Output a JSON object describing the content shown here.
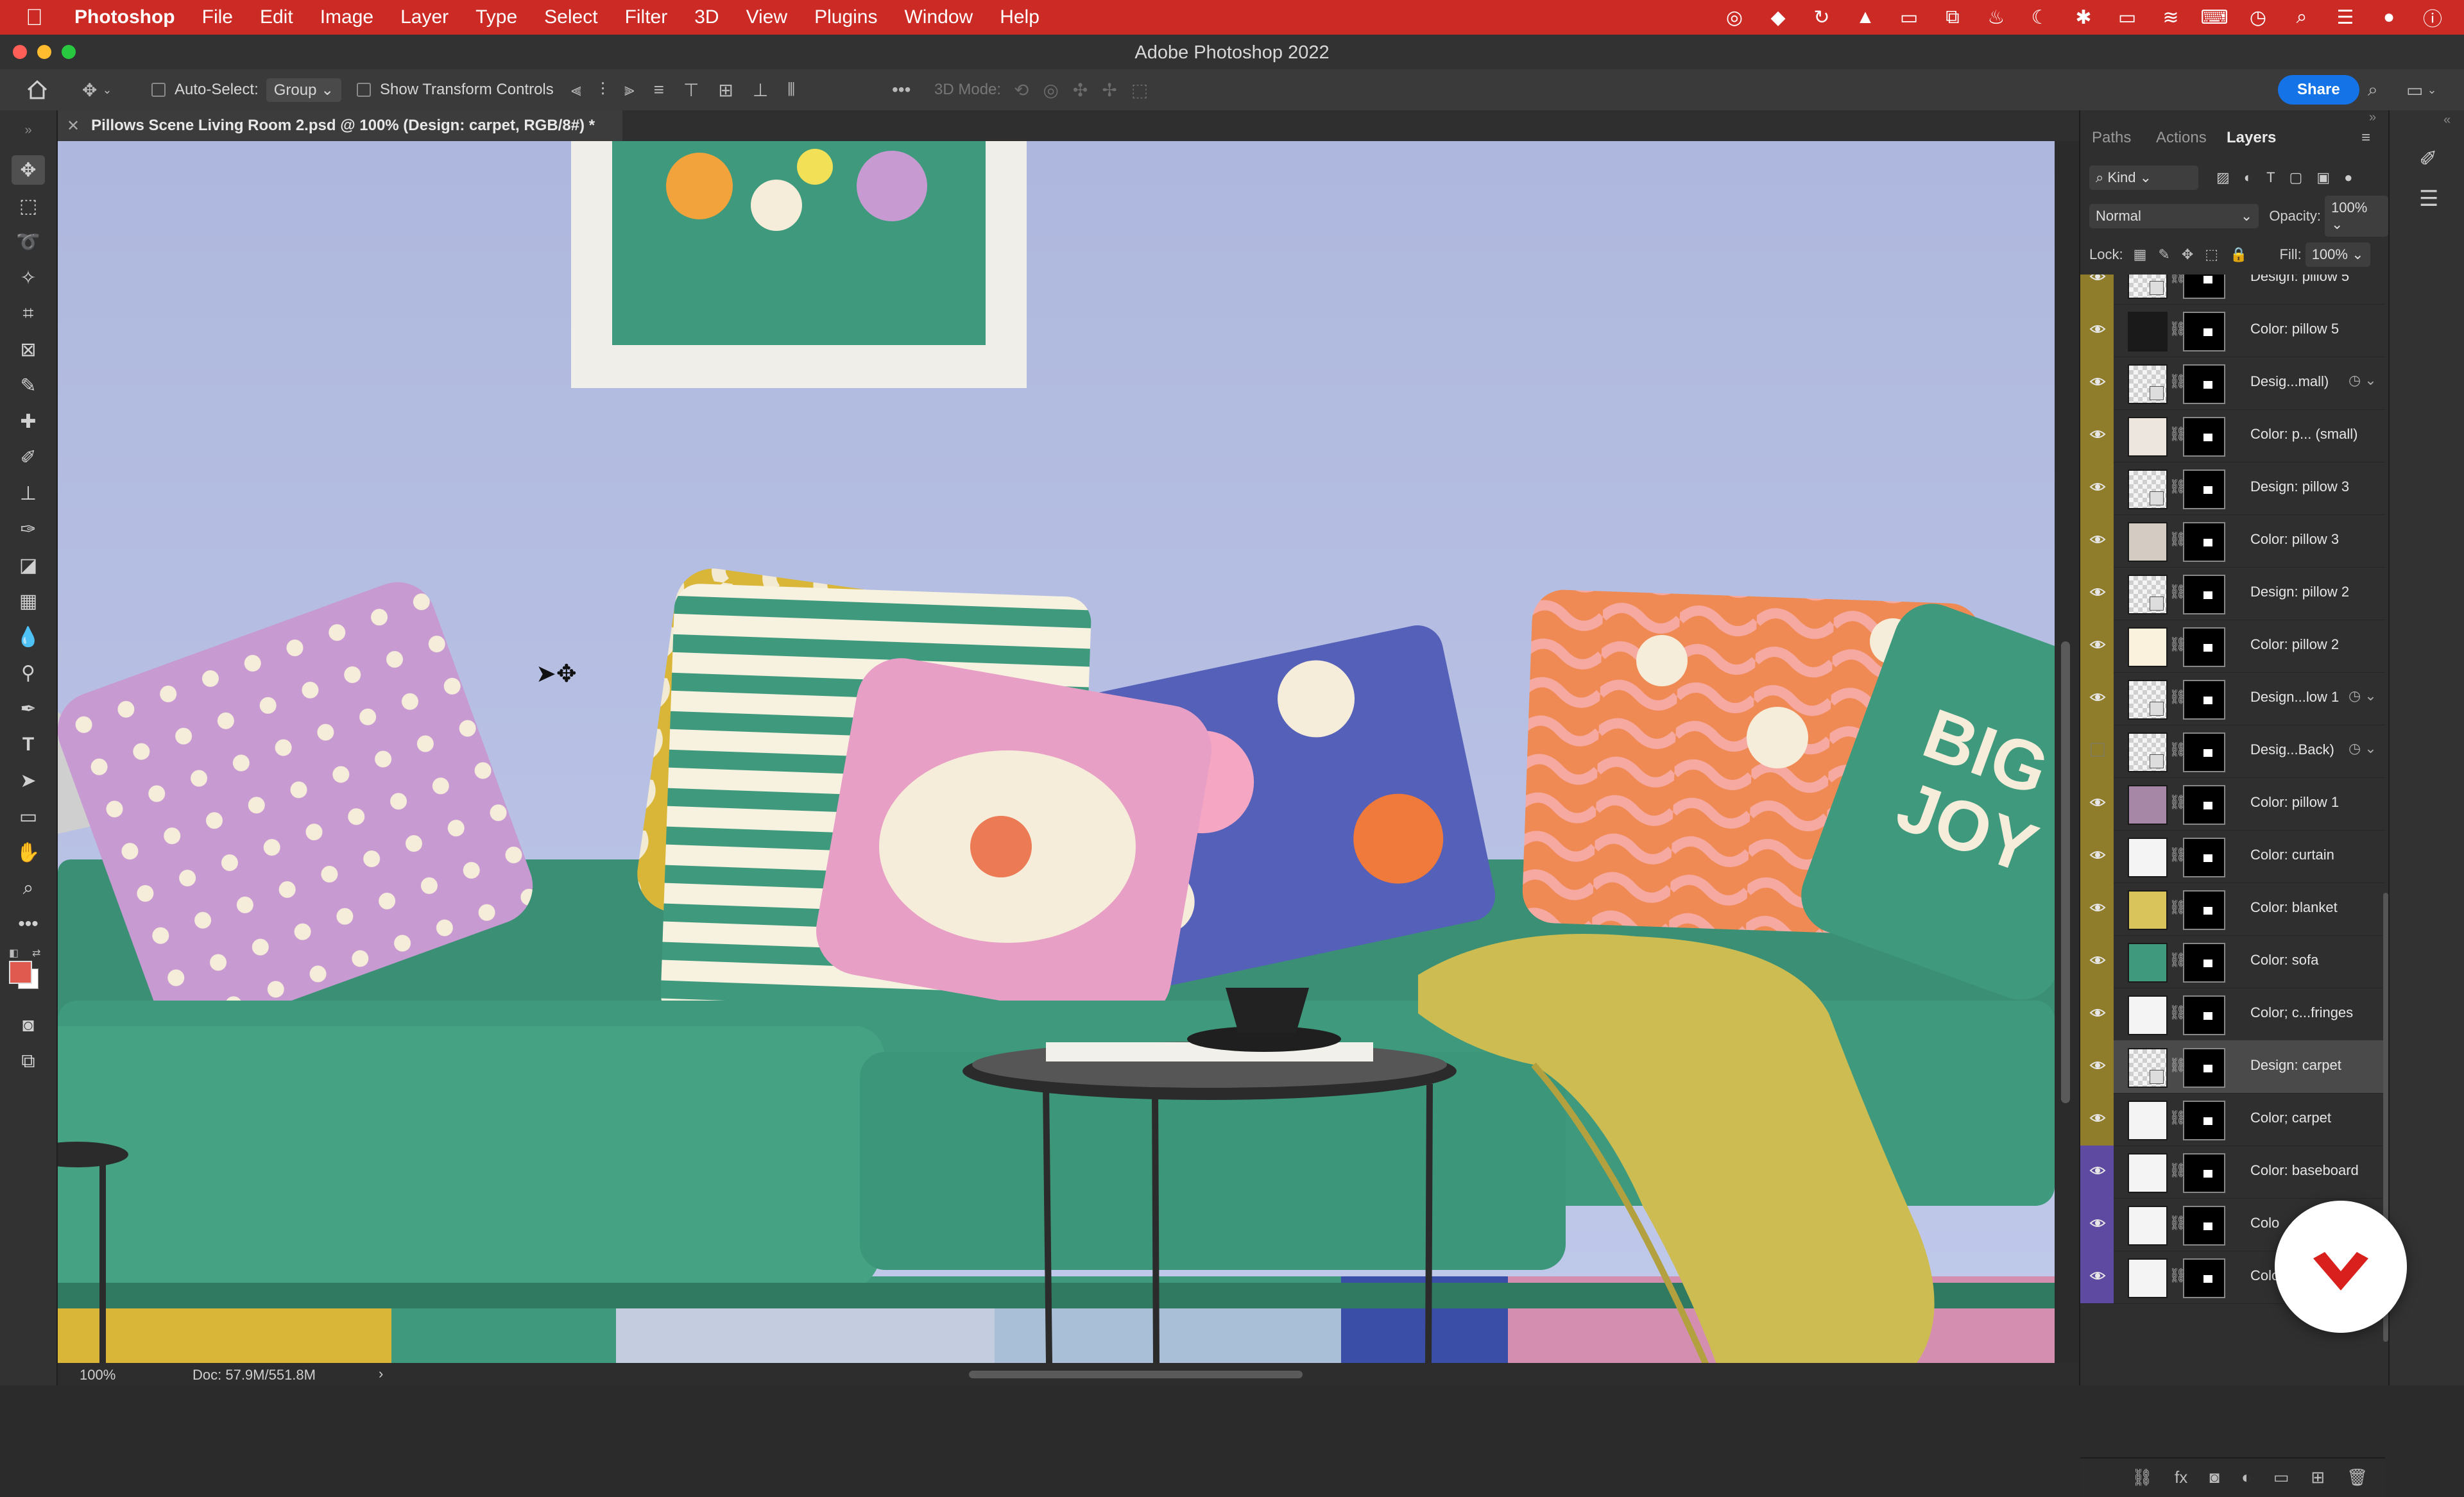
{
  "menubar": {
    "app_name": "Photoshop",
    "items": [
      "File",
      "Edit",
      "Image",
      "Layer",
      "Type",
      "Select",
      "Filter",
      "3D",
      "View",
      "Plugins",
      "Window",
      "Help"
    ]
  },
  "window": {
    "title": "Adobe Photoshop 2022"
  },
  "options": {
    "auto_select_label": "Auto-Select:",
    "auto_select_value": "Group",
    "transform_label": "Show Transform Controls",
    "mode_3d_label": "3D Mode:",
    "share_label": "Share"
  },
  "document": {
    "tab_title": "Pillows Scene Living Room 2.psd @ 100% (Design: carpet, RGB/8#) *"
  },
  "status": {
    "zoom": "100%",
    "doc_size": "Doc: 57.9M/551.8M",
    "arrow": "›"
  },
  "panel": {
    "tabs": [
      "Paths",
      "Actions",
      "Layers"
    ],
    "kind_label": "Kind",
    "blend_mode": "Normal",
    "opacity_label": "Opacity:",
    "opacity_value": "100%",
    "lock_label": "Lock:",
    "fill_label": "Fill:",
    "fill_value": "100%"
  },
  "layers": [
    {
      "name": "Design: pillow 5",
      "group": "yellow",
      "visible": true,
      "thumb": "checker",
      "smart": true
    },
    {
      "name": "Color: pillow 5",
      "group": "yellow",
      "visible": true,
      "thumb": "#1a1a1a"
    },
    {
      "name": "Desig...mall)",
      "group": "yellow",
      "visible": true,
      "thumb": "checker",
      "smart": true,
      "extra": "◷ ⌄"
    },
    {
      "name": "Color: p... (small)",
      "group": "yellow",
      "visible": true,
      "thumb": "#ece6de"
    },
    {
      "name": "Design: pillow 3",
      "group": "yellow",
      "visible": true,
      "thumb": "checker",
      "smart": true
    },
    {
      "name": "Color: pillow 3",
      "group": "yellow",
      "visible": true,
      "thumb": "#d4cbc2"
    },
    {
      "name": "Design: pillow 2",
      "group": "yellow",
      "visible": true,
      "thumb": "checker",
      "smart": true
    },
    {
      "name": "Color: pillow 2",
      "group": "yellow",
      "visible": true,
      "thumb": "#faf2dc"
    },
    {
      "name": "Design...low 1",
      "group": "yellow",
      "visible": true,
      "thumb": "checker",
      "smart": true,
      "extra": "◷ ⌄"
    },
    {
      "name": "Desig...Back)",
      "group": "yellow",
      "visible": false,
      "thumb": "checker",
      "smart": true,
      "extra": "◷ ⌄"
    },
    {
      "name": "Color: pillow 1",
      "group": "yellow",
      "visible": true,
      "thumb": "#a688a6"
    },
    {
      "name": "Color: curtain",
      "group": "yellow",
      "visible": true,
      "thumb": "#f4f4f4"
    },
    {
      "name": "Color: blanket",
      "group": "yellow",
      "visible": true,
      "thumb": "#d9c45c"
    },
    {
      "name": "Color: sofa",
      "group": "yellow",
      "visible": true,
      "thumb": "#3f9a7d"
    },
    {
      "name": "Color; c...fringes",
      "group": "yellow",
      "visible": true,
      "thumb": "#f4f4f4"
    },
    {
      "name": "Design: carpet",
      "group": "yellow",
      "visible": true,
      "thumb": "checker",
      "smart": true,
      "selected": true
    },
    {
      "name": "Color; carpet",
      "group": "yellow",
      "visible": true,
      "thumb": "#f4f4f4"
    },
    {
      "name": "Color: baseboard",
      "group": "purple",
      "visible": true,
      "thumb": "#f4f4f4"
    },
    {
      "name": "Colo",
      "group": "purple",
      "visible": true,
      "thumb": "#f4f4f4"
    },
    {
      "name": "Colo",
      "group": "purple",
      "visible": true,
      "thumb": "#f4f4f4"
    }
  ],
  "colors": {
    "menubar": "#cc2a25",
    "group_yellow": "#8f7d2c",
    "group_purple": "#5e4aa0",
    "foreground": "#e05a4f",
    "background": "#ffffff",
    "accent": "#1473e6"
  },
  "icons": [
    "apple-icon",
    "home-icon",
    "move-tool-icon",
    "search-icon",
    "eye-icon",
    "link-chain-icon",
    "lock-icon"
  ]
}
